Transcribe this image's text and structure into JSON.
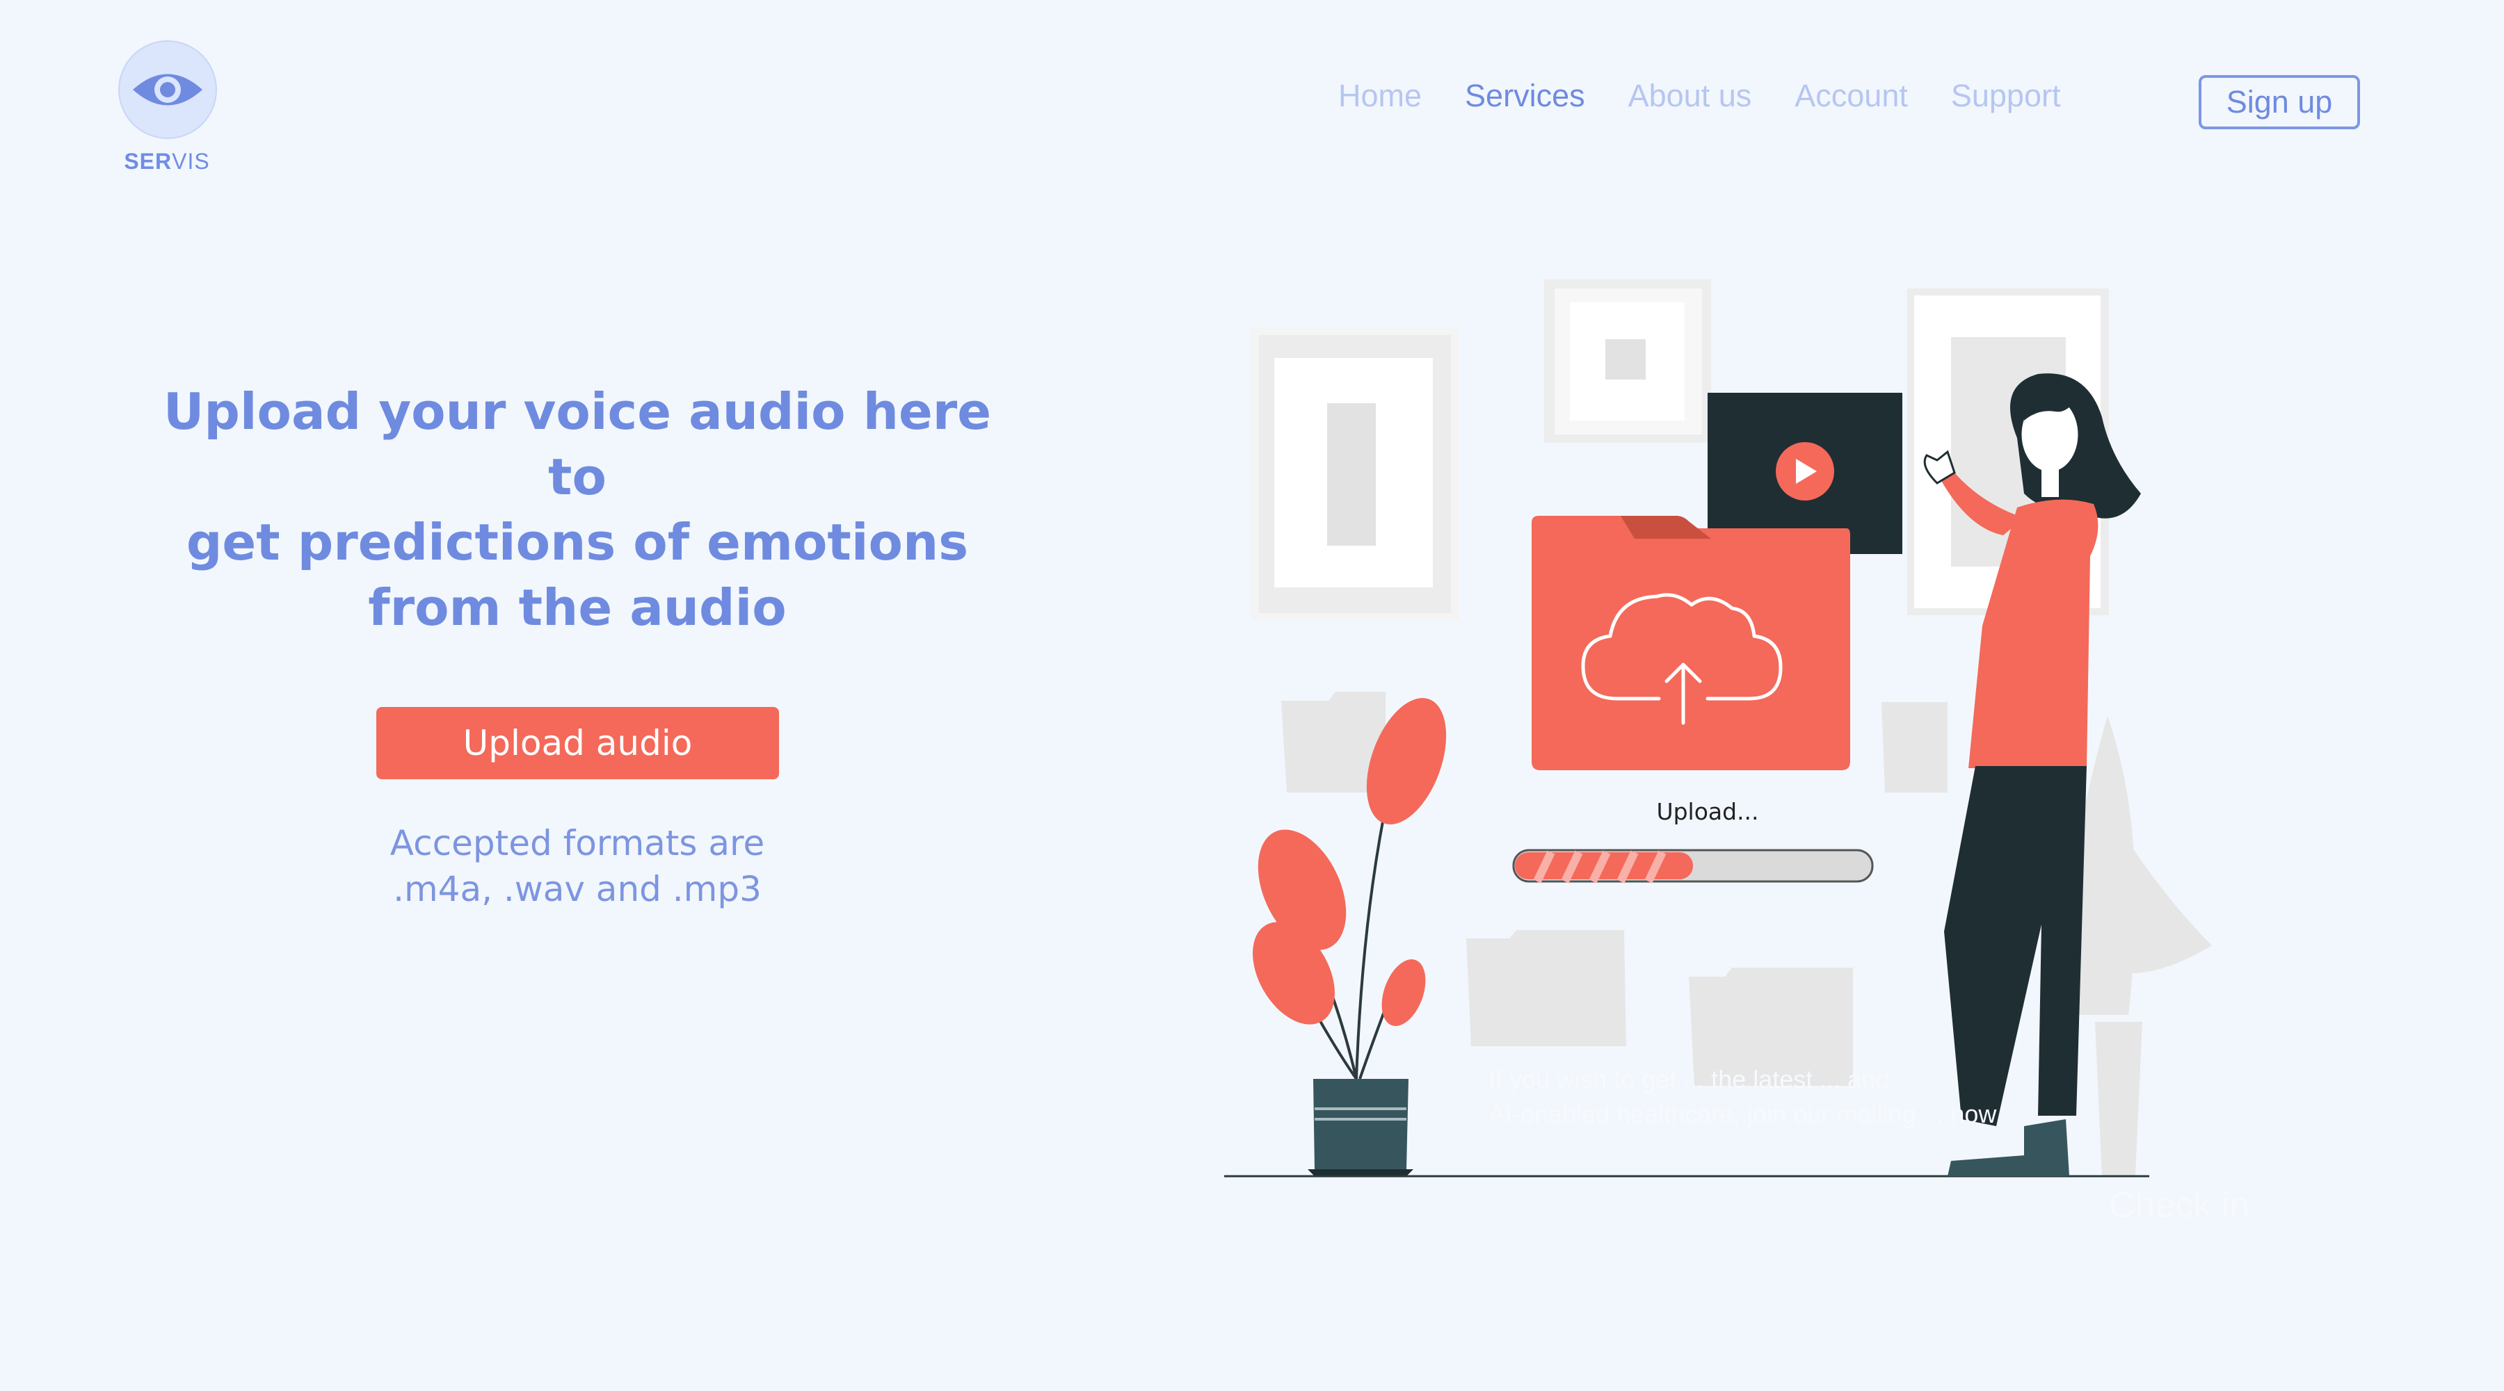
{
  "brand": {
    "name_bold": "SER",
    "name_rest": "VIS"
  },
  "nav": {
    "items": [
      {
        "label": "Home",
        "active": false
      },
      {
        "label": "Services",
        "active": true
      },
      {
        "label": "About us",
        "active": false
      },
      {
        "label": "Account",
        "active": false
      },
      {
        "label": "Support",
        "active": false
      }
    ],
    "signup_label": "Sign up"
  },
  "hero": {
    "headline_lines": [
      "Upload your voice audio here to",
      "get predictions of emotions",
      "from the audio"
    ],
    "upload_button_label": "Upload audio",
    "formats_lines": [
      "Accepted formats are",
      ".m4a, .wav and .mp3"
    ]
  },
  "illustration": {
    "upload_status_label": "Upload...",
    "progress": 0.5,
    "faint_text_lines": [
      "If you wish to get ... the latest ... and",
      "AI-enabled healthcare, join our mailing ... now"
    ],
    "checkin_label": "Check in"
  },
  "colors": {
    "background": "#f2f7fd",
    "accent": "#6f8be0",
    "coral": "#f4695a",
    "dark": "#1f2e33"
  }
}
